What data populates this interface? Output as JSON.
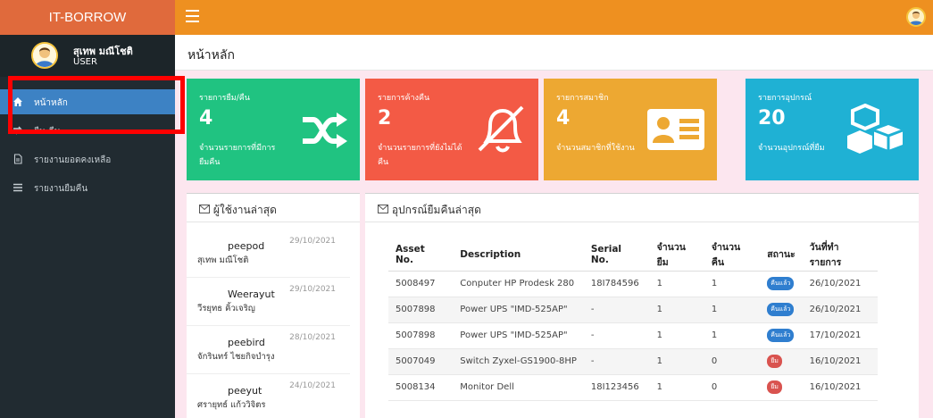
{
  "app": {
    "brand": "IT-BORROW"
  },
  "user": {
    "name": "สุเทพ มณีโชติ",
    "role": "USER"
  },
  "sidebar": {
    "items": [
      {
        "label": "หน้าหลัก",
        "icon": "home-icon",
        "active": true
      },
      {
        "label": "ยืม-คืน",
        "icon": "exchange-icon",
        "active": false
      },
      {
        "label": "รายงานยอดคงเหลือ",
        "icon": "file-icon",
        "active": false
      },
      {
        "label": "รายงานยืมคืน",
        "icon": "list-icon",
        "active": false
      }
    ]
  },
  "page": {
    "title": "หน้าหลัก"
  },
  "stats": [
    {
      "title": "รายการยืม/คืน",
      "value": "4",
      "desc": "จำนวนรายการที่มีการยืมคืน",
      "color": "#20c381",
      "icon": "shuffle-icon"
    },
    {
      "title": "รายการค้างคืน",
      "value": "2",
      "desc": "จำนวนรายการที่ยังไม่ได้คืน",
      "color": "#f35a45",
      "icon": "bell-slash-icon"
    },
    {
      "title": "รายการสมาชิก",
      "value": "4",
      "desc": "จำนวนสมาชิกที่ใช้งาน",
      "color": "#eda832",
      "icon": "id-card-icon"
    },
    {
      "title": "รายการอุปกรณ์",
      "value": "20",
      "desc": "จำนวนอุปกรณ์ที่ยืม",
      "color": "#1fb1d4",
      "icon": "cubes-icon"
    }
  ],
  "recent_users": {
    "title": "ผู้ใช้งานล่าสุด",
    "items": [
      {
        "username": "peepod",
        "fullname": "สุเทพ มณีโชติ",
        "date": "29/10/2021"
      },
      {
        "username": "Weerayut",
        "fullname": "วีรยุทธ คิ้วเจริญ",
        "date": "29/10/2021"
      },
      {
        "username": "peebird",
        "fullname": "จักรินทร์ ไชยกิจบำรุง",
        "date": "28/10/2021"
      },
      {
        "username": "peeyut",
        "fullname": "ศรายุทธ์ แก้ววิจิตร",
        "date": "24/10/2021"
      }
    ]
  },
  "recent_borrows": {
    "title": "อุปกรณ์ยืมคืนล่าสุด",
    "columns": [
      "Asset No.",
      "Description",
      "Serial No.",
      "จำนวนยืม",
      "จำนวนคืน",
      "สถานะ",
      "วันที่ทำรายการ"
    ],
    "rows": [
      {
        "asset": "5008497",
        "description": "Conputer HP Prodesk 280",
        "serial": "18I784596",
        "borrow": "1",
        "returned": "1",
        "status": "คืนแล้ว",
        "status_color": "blue",
        "date": "26/10/2021"
      },
      {
        "asset": "5007898",
        "description": "Power UPS \"IMD-525AP\"",
        "serial": "-",
        "borrow": "1",
        "returned": "1",
        "status": "คืนแล้ว",
        "status_color": "blue",
        "date": "26/10/2021"
      },
      {
        "asset": "5007898",
        "description": "Power UPS \"IMD-525AP\"",
        "serial": "-",
        "borrow": "1",
        "returned": "1",
        "status": "คืนแล้ว",
        "status_color": "blue",
        "date": "17/10/2021"
      },
      {
        "asset": "5007049",
        "description": "Switch Zyxel-GS1900-8HP",
        "serial": "-",
        "borrow": "1",
        "returned": "0",
        "status": "ยืม",
        "status_color": "red",
        "date": "16/10/2021"
      },
      {
        "asset": "5008134",
        "description": "Monitor Dell",
        "serial": "18I123456",
        "borrow": "1",
        "returned": "0",
        "status": "ยืม",
        "status_color": "red",
        "date": "16/10/2021"
      }
    ]
  }
}
